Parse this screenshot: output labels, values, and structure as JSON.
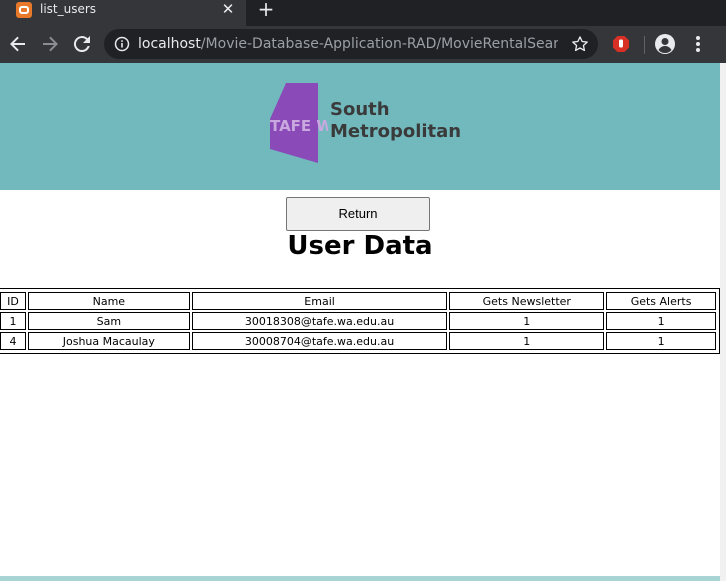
{
  "browser": {
    "tab_title": "list_users",
    "tab_close": "✕",
    "new_tab": "+",
    "url_host": "localhost",
    "url_path": "/Movie-Database-Application-RAD/MovieRentalSearchA..."
  },
  "banner": {
    "logo_mark": "TAFE WA",
    "logo_line1": "South",
    "logo_line2": "Metropolitan",
    "color": "#72b9be"
  },
  "page": {
    "return_label": "Return",
    "title": "User Data"
  },
  "table": {
    "columns": [
      "ID",
      "Name",
      "Email",
      "Gets Newsletter",
      "Gets Alerts"
    ],
    "rows": [
      [
        "1",
        "Sam",
        "30018308@tafe.wa.edu.au",
        "1",
        "1"
      ],
      [
        "4",
        "Joshua Macaulay",
        "30008704@tafe.wa.edu.au",
        "1",
        "1"
      ]
    ]
  }
}
